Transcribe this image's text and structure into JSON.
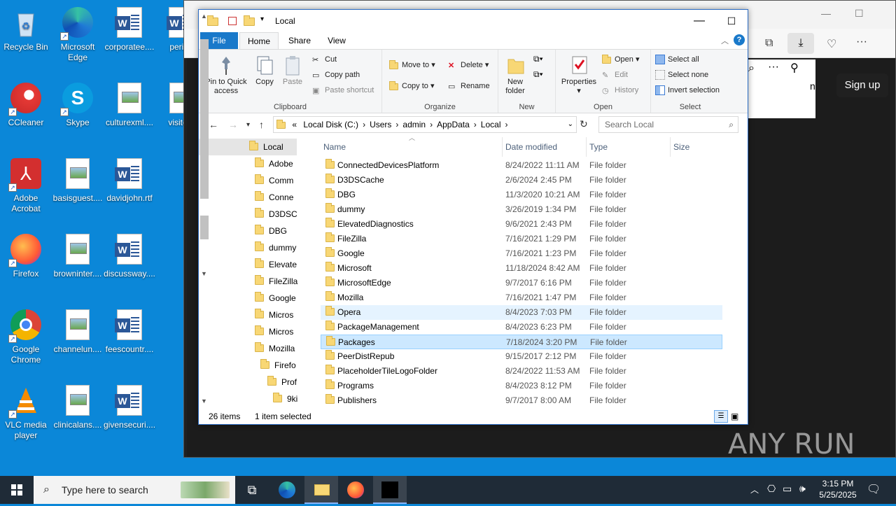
{
  "desktop": {
    "icons": [
      {
        "label": "Recycle Bin",
        "kind": "recycle"
      },
      {
        "label": "Microsoft Edge",
        "kind": "edge"
      },
      {
        "label": "corporatee....",
        "kind": "word"
      },
      {
        "label": "period",
        "kind": "word"
      },
      {
        "label": "CCleaner",
        "kind": "ccleaner"
      },
      {
        "label": "Skype",
        "kind": "skype"
      },
      {
        "label": "culturexml....",
        "kind": "doc"
      },
      {
        "label": "visitors",
        "kind": "doc"
      },
      {
        "label": "Adobe Acrobat",
        "kind": "acrobat"
      },
      {
        "label": "basisguest....",
        "kind": "doc"
      },
      {
        "label": "davidjohn.rtf",
        "kind": "word"
      },
      {
        "label": "Firefox",
        "kind": "firefox"
      },
      {
        "label": "browninter....",
        "kind": "doc"
      },
      {
        "label": "discussway....",
        "kind": "word"
      },
      {
        "label": "Google Chrome",
        "kind": "chrome"
      },
      {
        "label": "channelun....",
        "kind": "doc"
      },
      {
        "label": "feescountr....",
        "kind": "word"
      },
      {
        "label": "VLC media player",
        "kind": "vlc"
      },
      {
        "label": "clinicalans....",
        "kind": "doc"
      },
      {
        "label": "givensecuri....",
        "kind": "word"
      }
    ]
  },
  "browser": {
    "signup_label": "Sign up",
    "partial_text": "n"
  },
  "explorer": {
    "title": "Local",
    "tabs": {
      "file": "File",
      "home": "Home",
      "share": "Share",
      "view": "View"
    },
    "ribbon": {
      "clipboard": {
        "label": "Clipboard",
        "pin": "Pin to Quick access",
        "copy": "Copy",
        "paste": "Paste",
        "cut": "Cut",
        "copy_path": "Copy path",
        "paste_shortcut": "Paste shortcut"
      },
      "organize": {
        "label": "Organize",
        "move_to": "Move to",
        "copy_to": "Copy to",
        "delete": "Delete",
        "rename": "Rename"
      },
      "new": {
        "label": "New",
        "new_folder": "New folder"
      },
      "open": {
        "label": "Open",
        "properties": "Properties",
        "open": "Open",
        "edit": "Edit",
        "history": "History"
      },
      "select": {
        "label": "Select",
        "select_all": "Select all",
        "select_none": "Select none",
        "invert": "Invert selection"
      }
    },
    "address": {
      "prefix": "«",
      "crumbs": [
        "Local Disk (C:)",
        "Users",
        "admin",
        "AppData",
        "Local"
      ],
      "search_placeholder": "Search Local"
    },
    "nav_items": [
      "Local",
      "Adobe",
      "Comm",
      "Conne",
      "D3DSC",
      "DBG",
      "dummy",
      "Elevate",
      "FileZilla",
      "Google",
      "Micros",
      "Micros",
      "Mozilla",
      "Firefo",
      "Prof",
      "9ki"
    ],
    "columns": {
      "name": "Name",
      "date": "Date modified",
      "type": "Type",
      "size": "Size"
    },
    "files": [
      {
        "name": "ConnectedDevicesPlatform",
        "date": "8/24/2022 11:11 AM",
        "type": "File folder"
      },
      {
        "name": "D3DSCache",
        "date": "2/6/2024 2:45 PM",
        "type": "File folder"
      },
      {
        "name": "DBG",
        "date": "11/3/2020 10:21 AM",
        "type": "File folder"
      },
      {
        "name": "dummy",
        "date": "3/26/2019 1:34 PM",
        "type": "File folder"
      },
      {
        "name": "ElevatedDiagnostics",
        "date": "9/6/2021 2:43 PM",
        "type": "File folder"
      },
      {
        "name": "FileZilla",
        "date": "7/16/2021 1:29 PM",
        "type": "File folder"
      },
      {
        "name": "Google",
        "date": "7/16/2021 1:23 PM",
        "type": "File folder"
      },
      {
        "name": "Microsoft",
        "date": "11/18/2024 8:42 AM",
        "type": "File folder"
      },
      {
        "name": "MicrosoftEdge",
        "date": "9/7/2017 6:16 PM",
        "type": "File folder"
      },
      {
        "name": "Mozilla",
        "date": "7/16/2021 1:47 PM",
        "type": "File folder"
      },
      {
        "name": "Opera",
        "date": "8/4/2023 7:03 PM",
        "type": "File folder"
      },
      {
        "name": "PackageManagement",
        "date": "8/4/2023 6:23 PM",
        "type": "File folder"
      },
      {
        "name": "Packages",
        "date": "7/18/2024 3:20 PM",
        "type": "File folder"
      },
      {
        "name": "PeerDistRepub",
        "date": "9/15/2017 2:12 PM",
        "type": "File folder"
      },
      {
        "name": "PlaceholderTileLogoFolder",
        "date": "8/24/2022 11:53 AM",
        "type": "File folder"
      },
      {
        "name": "Programs",
        "date": "8/4/2023 8:12 PM",
        "type": "File folder"
      },
      {
        "name": "Publishers",
        "date": "9/7/2017 8:00 AM",
        "type": "File folder"
      }
    ],
    "hover_index": 10,
    "selected_index": 12,
    "status": {
      "count": "26 items",
      "selected": "1 item selected"
    }
  },
  "taskbar": {
    "search_placeholder": "Type here to search",
    "time": "3:15 PM",
    "date": "5/25/2025"
  },
  "watermark": "ANY RUN"
}
